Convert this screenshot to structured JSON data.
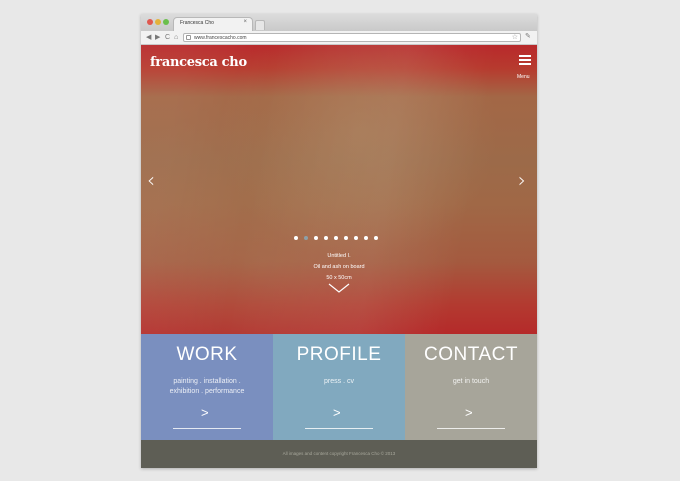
{
  "browser": {
    "tab_title": "Francesca Cho",
    "tab_close": "×",
    "url": "www.francescacho.com",
    "back": "◀",
    "forward": "▶",
    "reload": "C",
    "home": "⌂",
    "star": "☆",
    "wrench": "✎"
  },
  "header": {
    "logo": "francesca cho",
    "menu_label": "Menu"
  },
  "hero": {
    "prev_arrow": "‹",
    "next_arrow": "›",
    "slide_count": 9,
    "active_slide": 2,
    "caption_lines": [
      "Untitled I.",
      "Oil and ash on board",
      "50 x 50cm"
    ]
  },
  "tiles": [
    {
      "title": "WORK",
      "subtitle_lines": [
        "painting . installation .",
        "exhibition . performance"
      ],
      "arrow": ">",
      "color": "#7a8fbf"
    },
    {
      "title": "PROFILE",
      "subtitle_lines": [
        "press . cv"
      ],
      "arrow": ">",
      "color": "#81a9bf"
    },
    {
      "title": "CONTACT",
      "subtitle_lines": [
        "get in touch"
      ],
      "arrow": ">",
      "color": "#a7a59a"
    }
  ],
  "footer": {
    "text": "All images and content copyright Francesca Cho © 2013"
  },
  "colors": {
    "footer_bg": "#5e5e55",
    "active_dot": "#8da0a8"
  }
}
